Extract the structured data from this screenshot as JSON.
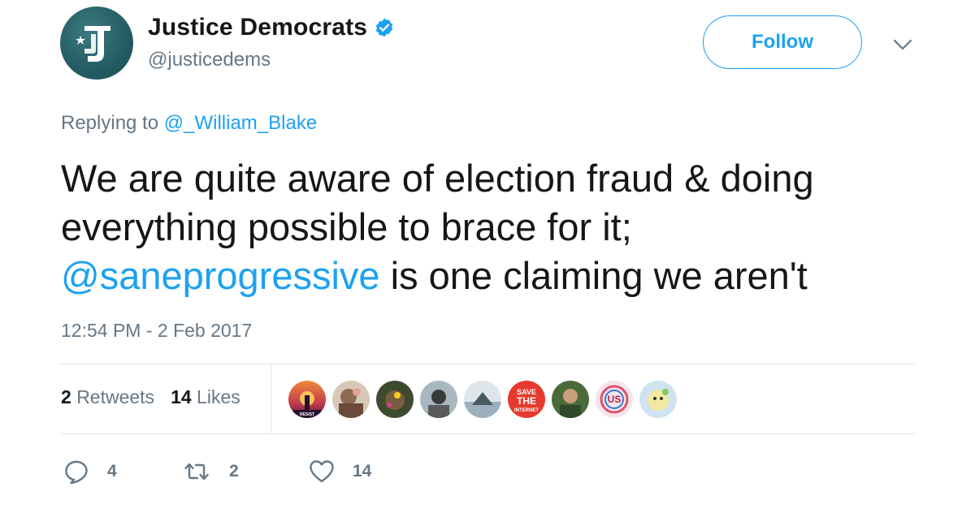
{
  "author": {
    "display_name": "Justice Democrats",
    "handle": "@justicedems",
    "verified": true,
    "avatar_icon": "justice-democrats-logo"
  },
  "header": {
    "follow_label": "Follow",
    "menu_icon": "chevron-down-icon"
  },
  "reply": {
    "prefix": "Replying to",
    "to_handle": "@_William_Blake"
  },
  "tweet": {
    "text_line1": "We are quite aware of election fraud & doing",
    "text_line2": "everything possible to brace for it;",
    "mention": "@saneprogressive",
    "text_line3_rest": " is one claiming we aren't",
    "timestamp": "12:54 PM - 2 Feb 2017"
  },
  "stats": {
    "retweets_count": "2",
    "retweets_label": "Retweets",
    "likes_count": "14",
    "likes_label": "Likes"
  },
  "likers": [
    {
      "name": "liker-avatar-resist",
      "text": "RESIST"
    },
    {
      "name": "liker-avatar-2"
    },
    {
      "name": "liker-avatar-3"
    },
    {
      "name": "liker-avatar-4"
    },
    {
      "name": "liker-avatar-5"
    },
    {
      "name": "liker-avatar-save-the-internet",
      "text": "SAVE THE INTERNET"
    },
    {
      "name": "liker-avatar-7"
    },
    {
      "name": "liker-avatar-us",
      "text": "US"
    },
    {
      "name": "liker-avatar-9"
    }
  ],
  "actions": {
    "reply_count": "4",
    "retweet_count": "2",
    "like_count": "14"
  },
  "colors": {
    "accent": "#1da1f2",
    "secondary_text": "#657786",
    "primary_text": "#14171a",
    "divider": "#e1e8ed"
  }
}
